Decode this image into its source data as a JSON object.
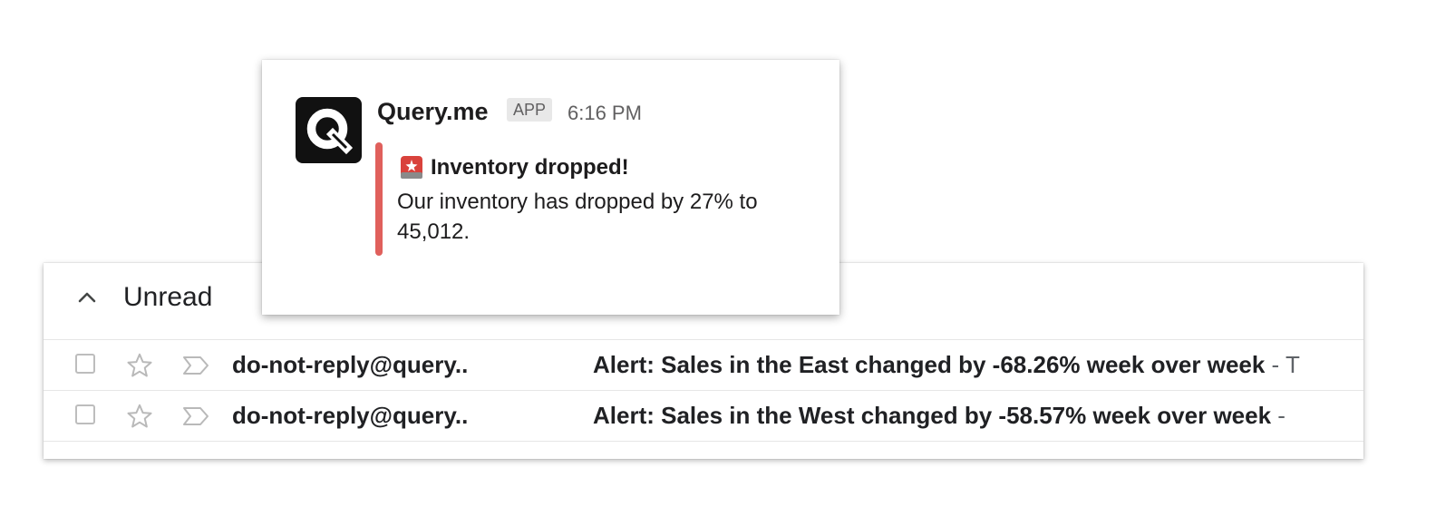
{
  "slack_message": {
    "app_name": "Query.me",
    "badge": "APP",
    "time": "6:16 PM",
    "avatar_icon": "query-me-logo-icon",
    "accent_color": "#e0605c",
    "alert_icon": "rotating-light-icon",
    "title": "Inventory dropped!",
    "body": "Our inventory has dropped by 27% to  45,012."
  },
  "inbox": {
    "section_title": "Unread",
    "section_icon": "chevron-up-icon",
    "rows": [
      {
        "sender": "do-not-reply@query..",
        "subject": "Alert: Sales in the East changed by -68.26% week over week",
        "snippet": " - T"
      },
      {
        "sender": "do-not-reply@query..",
        "subject": "Alert: Sales in the West changed by -58.57% week over week",
        "snippet": " -"
      }
    ]
  }
}
